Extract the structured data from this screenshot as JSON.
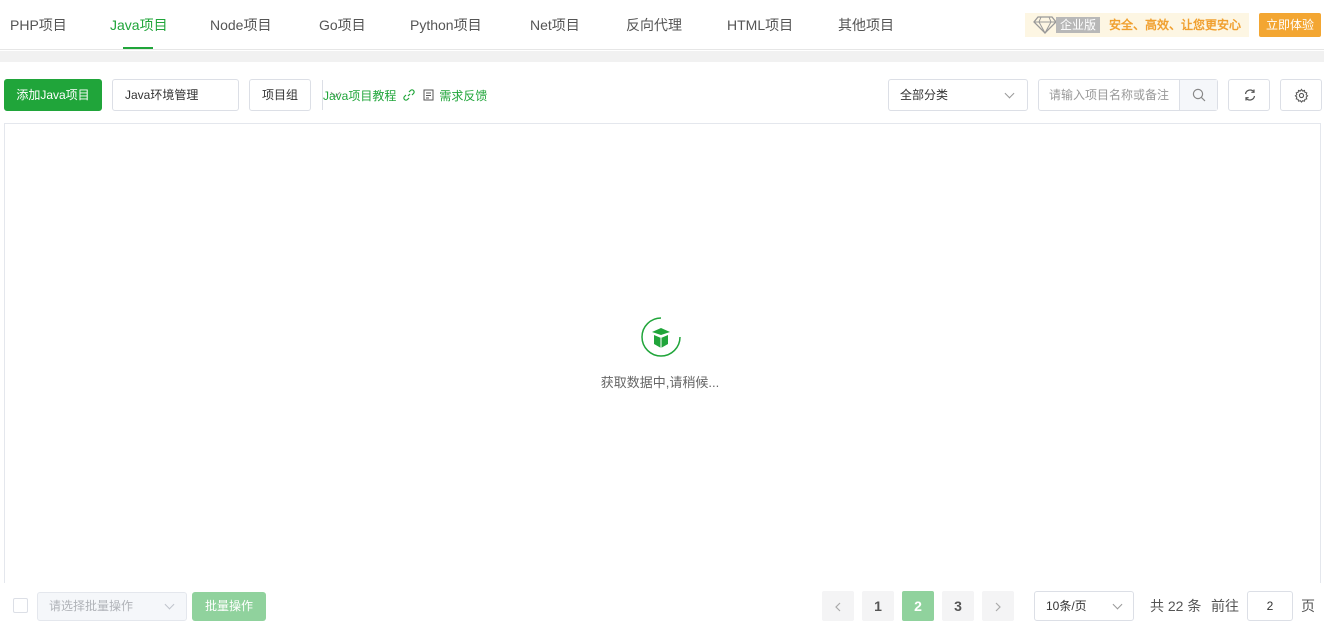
{
  "nav": {
    "tabs": [
      {
        "label": "PHP项目"
      },
      {
        "label": "Java项目"
      },
      {
        "label": "Node项目"
      },
      {
        "label": "Go项目"
      },
      {
        "label": "Python项目"
      },
      {
        "label": "Net项目"
      },
      {
        "label": "反向代理"
      },
      {
        "label": "HTML项目"
      },
      {
        "label": "其他项目"
      }
    ],
    "active_tab": "Java项目",
    "edition": "企业版",
    "slogan": "安全、高效、让您更安心",
    "try_button": "立即体验"
  },
  "toolbar": {
    "add_button": "添加Java项目",
    "env_button": "Java环境管理",
    "group_button": "项目组",
    "tutorial_link": "Java项目教程",
    "feedback_link": "需求反馈",
    "category_select": "全部分类",
    "search_placeholder": "请输入项目名称或备注"
  },
  "table": {
    "loading_text": "获取数据中,请稍候..."
  },
  "footer": {
    "batch_placeholder": "请选择批量操作",
    "batch_button": "批量操作",
    "pages": [
      "1",
      "2",
      "3"
    ],
    "current_page": "2",
    "page_size": "10条/页",
    "total": "共 22 条",
    "goto_label": "前往",
    "goto_value": "2",
    "page_unit": "页"
  },
  "colors": {
    "accent": "#20a53a",
    "warning": "#f3a632"
  },
  "icons": [
    "diamond-icon",
    "link-icon",
    "document-icon",
    "chevron-down-icon",
    "search-icon",
    "refresh-icon",
    "gear-icon",
    "loading-spinner-icon",
    "chevron-left-icon",
    "chevron-right-icon"
  ]
}
